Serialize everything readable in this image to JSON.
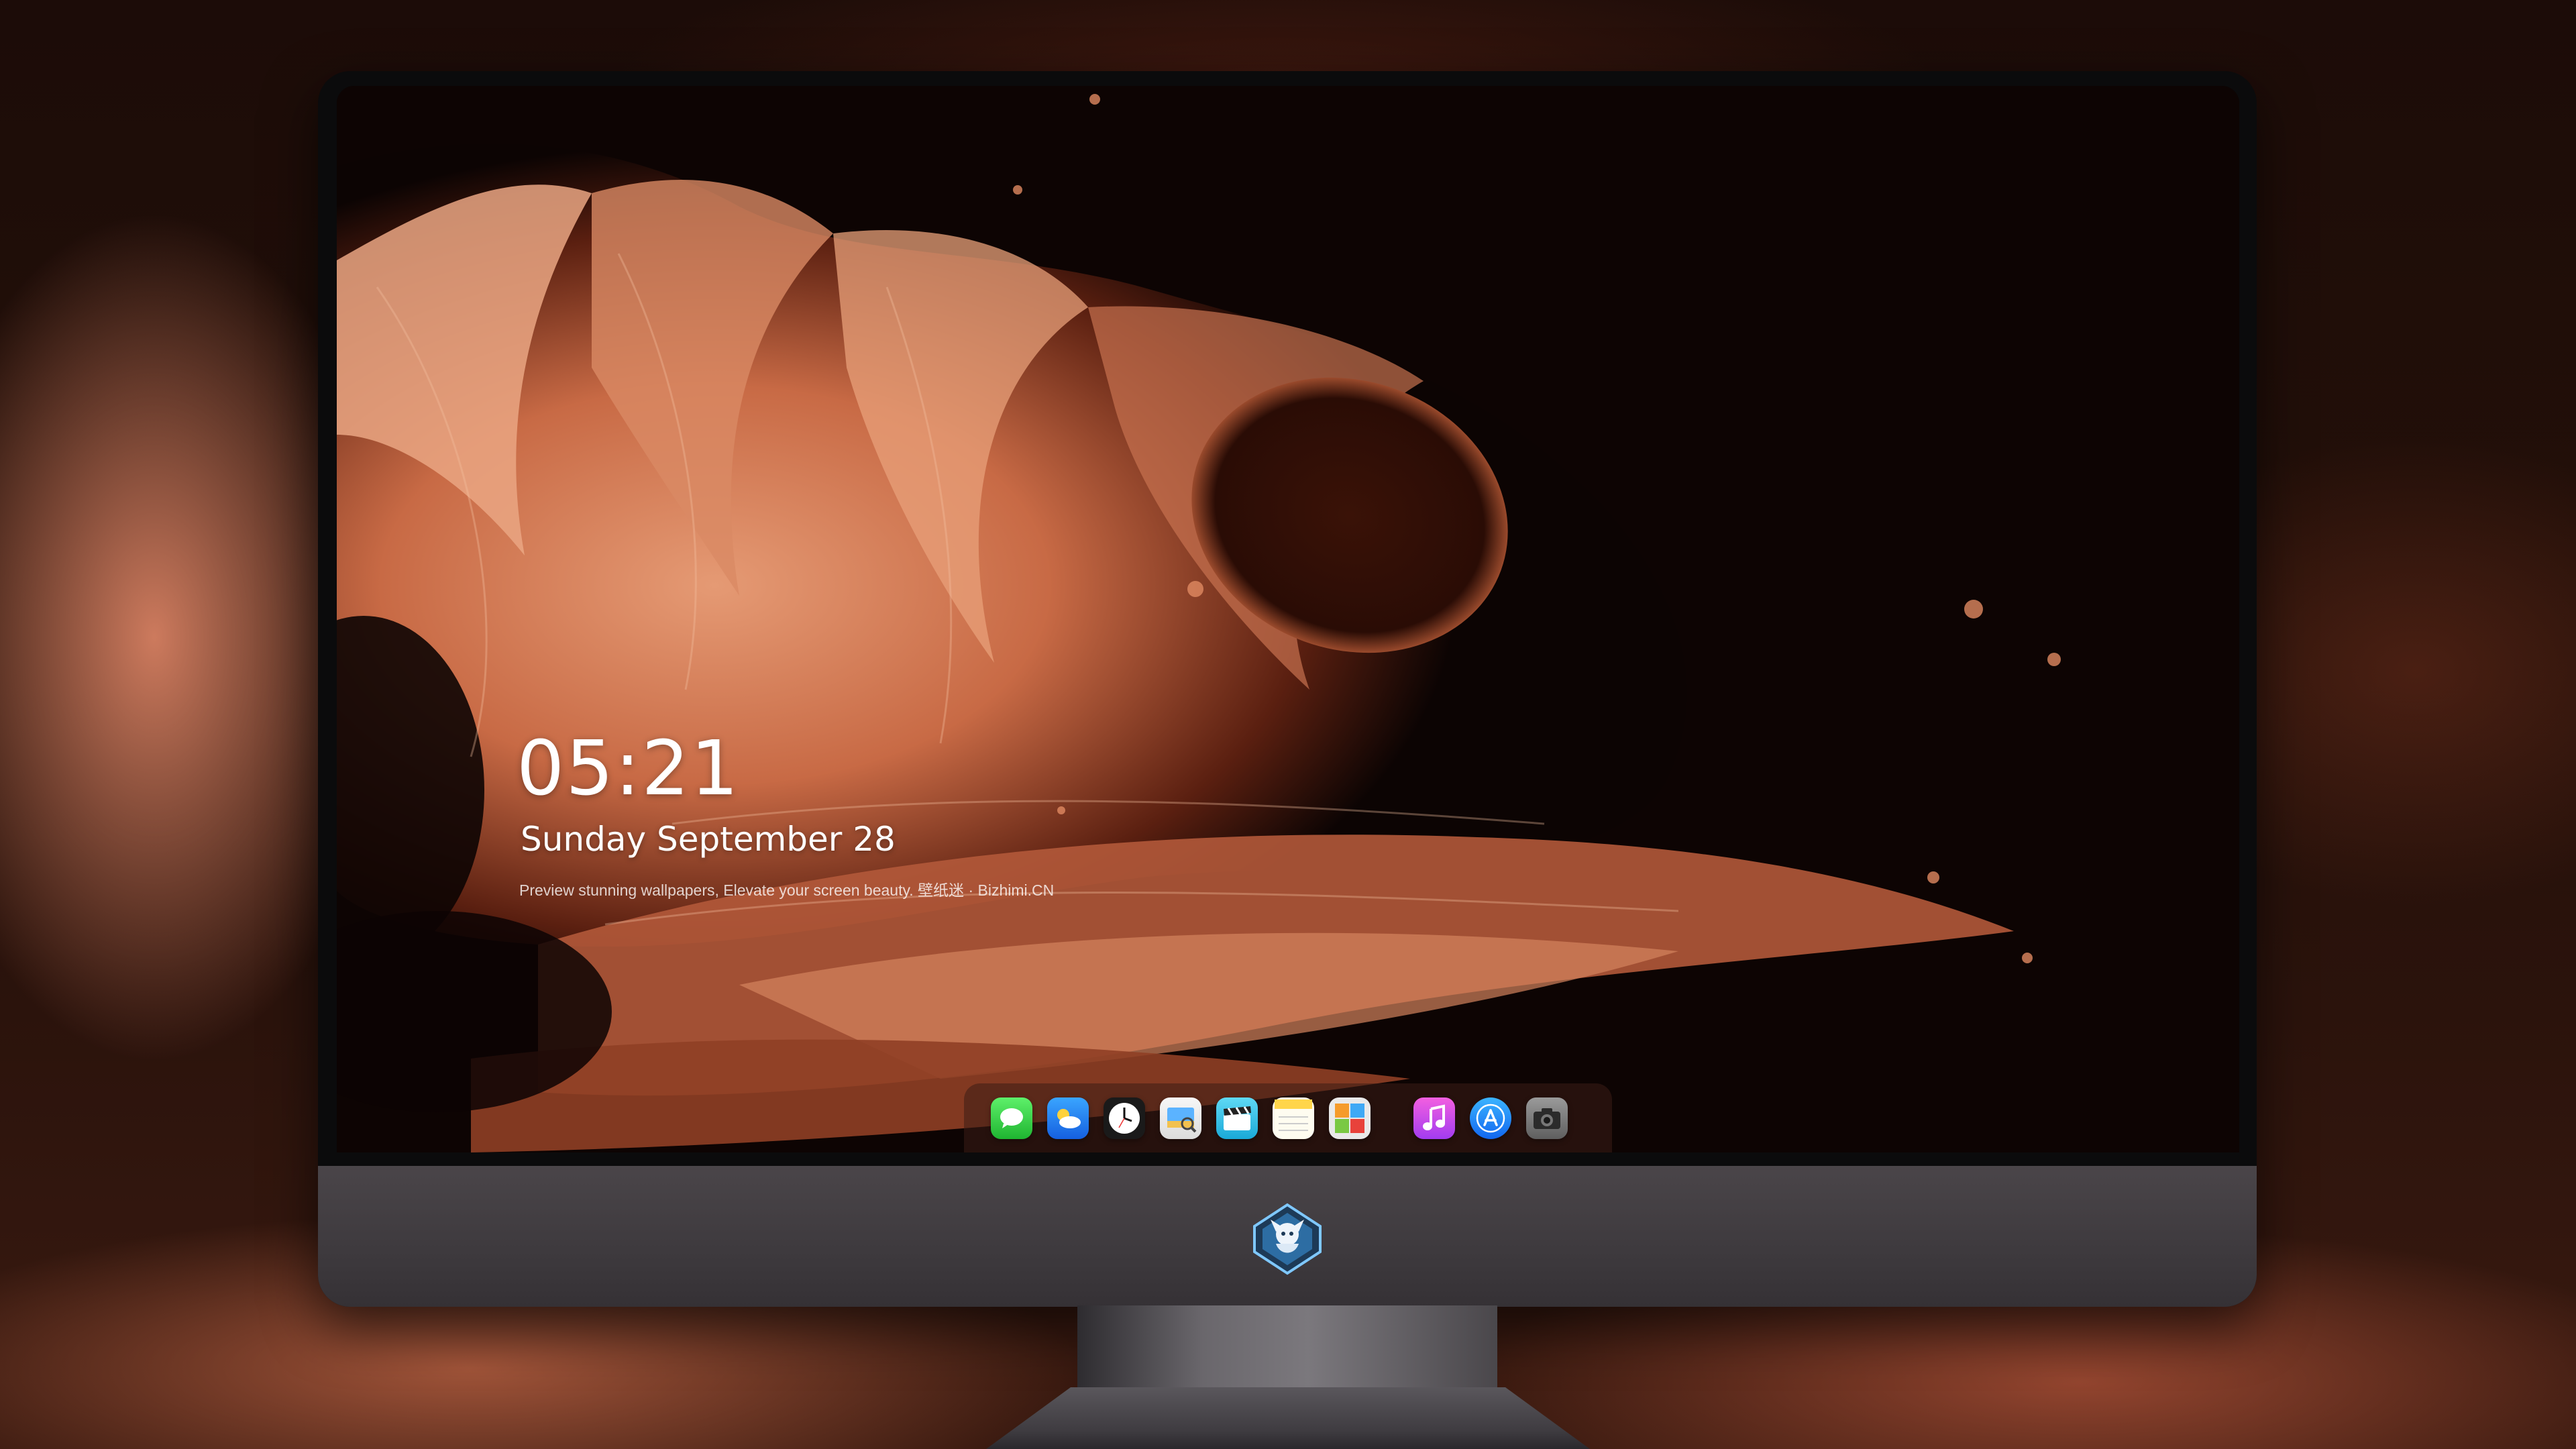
{
  "lockscreen": {
    "time": "05:21",
    "date": "Sunday September  28",
    "tagline": "Preview stunning wallpapers, Elevate your screen beauty. 壁纸迷 · Bizhimi.CN"
  },
  "dock": {
    "apps": [
      {
        "name": "messages-icon",
        "color": "#2ecc40"
      },
      {
        "name": "weather-icon",
        "color": "#1e88ff"
      },
      {
        "name": "clock-icon",
        "color": "#1a1a1a"
      },
      {
        "name": "preview-icon",
        "color": "#f2c14e"
      },
      {
        "name": "clips-icon",
        "color": "#3ac7ee"
      },
      {
        "name": "notes-icon",
        "color": "#ffd54a"
      },
      {
        "name": "photo-booth-icon",
        "color": "#e9e9e9"
      },
      {
        "name": "itunes-icon",
        "color": "#d94bd8"
      },
      {
        "name": "app-store-icon",
        "color": "#1b8cff"
      },
      {
        "name": "camera-icon",
        "color": "#6b6b6b"
      }
    ]
  },
  "colors": {
    "wallpaper_accent": "#d9835d",
    "wallpaper_dark": "#0c0403"
  }
}
